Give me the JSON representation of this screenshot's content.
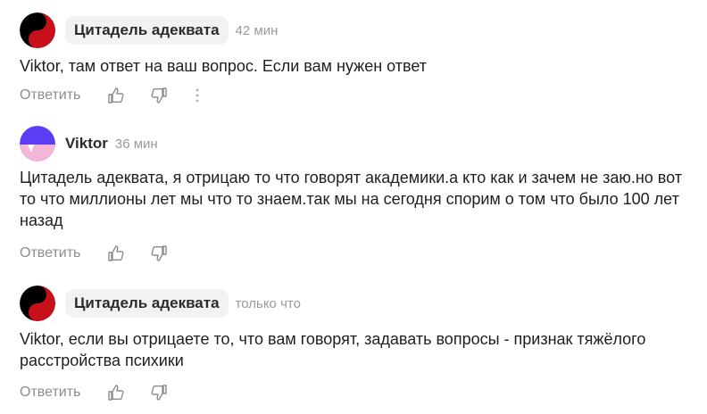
{
  "comments": [
    {
      "author": "Цитадель адеквата",
      "time": "42 мин",
      "text": "Viktor, там ответ на ваш вопрос. Если вам нужен ответ",
      "reply_label": "Ответить",
      "avatar_icon": "yin-yang-red-icon"
    },
    {
      "author": "Viktor",
      "time": "36 мин",
      "text": "Цитадель адеквата, я отрицаю то что говорят академики.а кто как и зачем не заю.но вот то что миллионы лет мы что то знаем.так мы на сегодня спорим о том что было 100 лет назад",
      "reply_label": "Ответить",
      "avatar_icon": "purple-pink-abstract-icon"
    },
    {
      "author": "Цитадель адеквата",
      "time": "только что",
      "text": "Viktor, если вы отрицаете то, что вам говорят, задавать вопросы - признак тяжёлого расстройства психики",
      "reply_label": "Ответить",
      "avatar_icon": "yin-yang-red-icon"
    }
  ],
  "colors": {
    "pill_bg": "#f2f2f2",
    "muted": "#8c8c8c",
    "time": "#9a9a9a",
    "avatar_red": "#c8101a",
    "avatar_purple": "#5b3df5",
    "avatar_pink": "#f4b6d8"
  }
}
